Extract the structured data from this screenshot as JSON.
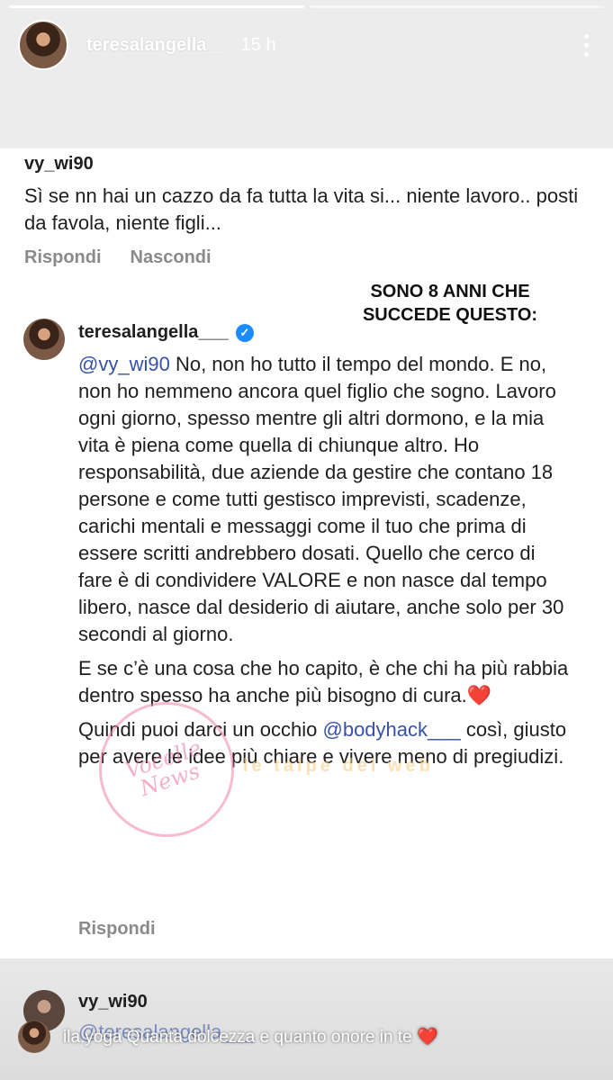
{
  "story": {
    "username": "teresalangella__",
    "time": "15 h"
  },
  "comment": {
    "username": "vy_wi90",
    "text": "Sì se nn hai un  cazzo da fa tutta la vita si... niente lavoro.. posti da favola, niente figli...",
    "reply_label": "Rispondi",
    "hide_label": "Nascondi"
  },
  "overlay_caption": "SONO 8 ANNI CHE SUCCEDE QUESTO:",
  "reply": {
    "username": "teresalangella___",
    "mention_1": "@vy_wi90",
    "paragraph_1": " No, non ho tutto il tempo del mondo. E no, non ho nemmeno ancora quel figlio che sogno. Lavoro ogni giorno, spesso mentre gli altri dormono, e la mia vita è piena come quella di chiunque altro. Ho responsabilità, due aziende da gestire che contano 18 persone e come tutti gestisco imprevisti, scadenze, carichi mentali e messaggi come il tuo che prima di essere scritti andrebbero dosati. Quello che cerco di fare è di condividere VALORE e non nasce dal tempo libero, nasce dal desiderio di aiutare, anche solo per 30 secondi al giorno.",
    "paragraph_2": "E se c’è una cosa che ho capito, è che chi ha più rabbia dentro spesso ha anche più bisogno di cura.",
    "heart": "❤️",
    "paragraph_3_pre": "Quindi puoi darci un occhio ",
    "mention_2": "@bodyhack___",
    "paragraph_3_post": " così, giusto per avere le idee più chiare e vivere meno di pregiudizi.",
    "reply_label": "Rispondi"
  },
  "comment_2": {
    "username": "vy_wi90",
    "text": "@teresalangella___"
  },
  "watermarks": {
    "logo_text": "Vocelle News",
    "text_2": "le talpe del web"
  },
  "reply_bar": {
    "text": "ila.yoga Quanta dolcezza e quanto onore in te ❤️"
  }
}
